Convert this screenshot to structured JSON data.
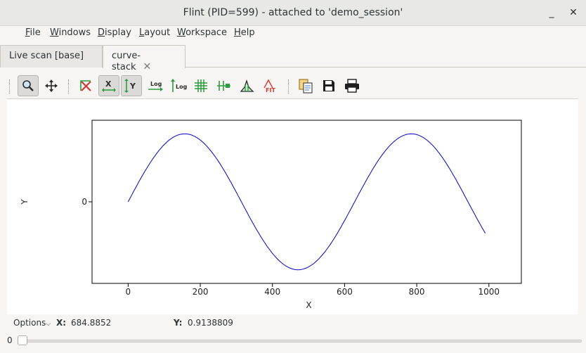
{
  "window": {
    "title": "Flint (PID=599) - attached to 'demo_session'",
    "minimize_glyph": "_",
    "close_glyph": "✕"
  },
  "menubar": [
    {
      "mnemonic": "F",
      "rest": "ile"
    },
    {
      "mnemonic": "W",
      "rest": "indows"
    },
    {
      "mnemonic": "D",
      "rest": "isplay"
    },
    {
      "mnemonic": "L",
      "rest": "ayout"
    },
    {
      "mnemonic": "W",
      "rest": "orkspace"
    },
    {
      "mnemonic": "H",
      "rest": "elp"
    }
  ],
  "tabs": [
    {
      "label": "Live scan [base]",
      "active": false
    },
    {
      "label": "curve-stack",
      "active": true,
      "close_glyph": "✕"
    }
  ],
  "toolbar": {
    "log_text": "Log",
    "fit_text": "FIT",
    "x_text": "X",
    "y_text": "Y",
    "icons": [
      "zoom-icon",
      "pan-icon",
      "reset-zoom-icon",
      "x-autoscale-icon",
      "y-autoscale-icon",
      "x-log-icon",
      "y-log-icon",
      "grid-icon",
      "curve-style-icon",
      "histogram-icon",
      "fit-icon",
      "copy-icon",
      "save-icon",
      "print-icon"
    ],
    "colors": {
      "green": "#2a9d3e",
      "red": "#d43a2f",
      "dark": "#2b2b2b"
    }
  },
  "chart_data": {
    "type": "line",
    "title": "",
    "xlabel": "X",
    "ylabel": "Y",
    "xlim": [
      -100,
      1090
    ],
    "ylim": [
      -1.2,
      1.2
    ],
    "x_ticks": [
      0,
      200,
      400,
      600,
      800,
      1000
    ],
    "y_ticks": [
      0
    ],
    "grid": false,
    "series": [
      {
        "color": "#0000cc",
        "function": "sin(2*pi*x/628)",
        "x_start": 0,
        "x_end": 990
      }
    ]
  },
  "status": {
    "options_label": "Options",
    "x_label": "X:",
    "x_value": "684.8852",
    "y_label": "Y:",
    "y_value": "0.9138809"
  },
  "slider": {
    "value": "0"
  }
}
